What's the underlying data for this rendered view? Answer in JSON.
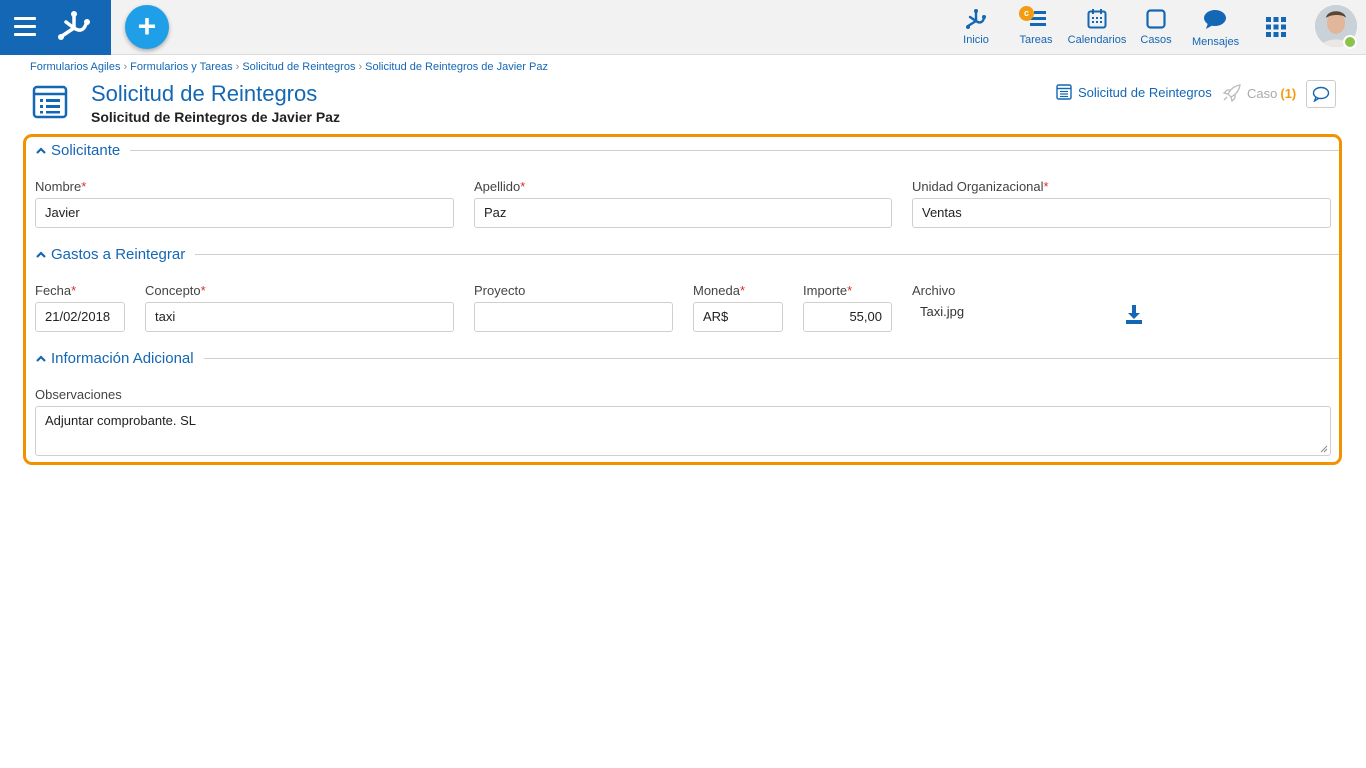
{
  "topbar": {
    "nav": [
      {
        "id": "inicio",
        "label": "Inicio"
      },
      {
        "id": "tareas",
        "label": "Tareas",
        "badge": "c"
      },
      {
        "id": "calendarios",
        "label": "Calendarios"
      },
      {
        "id": "casos",
        "label": "Casos"
      },
      {
        "id": "mensajes",
        "label": "Mensajes"
      }
    ]
  },
  "breadcrumb": [
    "Formularios Agiles",
    "Formularios y Tareas",
    "Solicitud de Reintegros",
    "Solicitud de Reintegros de Javier Paz"
  ],
  "header": {
    "title": "Solicitud de Reintegros",
    "subtitle": "Solicitud de Reintegros de Javier Paz",
    "form_link": "Solicitud de Reintegros",
    "case_label": "Caso",
    "case_count": "(1)"
  },
  "sections": {
    "solicitante": {
      "title": "Solicitante",
      "nombre_label": "Nombre",
      "nombre_value": "Javier",
      "apellido_label": "Apellido",
      "apellido_value": "Paz",
      "unidad_label": "Unidad Organizacional",
      "unidad_value": "Ventas"
    },
    "gastos": {
      "title": "Gastos a Reintegrar",
      "fecha_label": "Fecha",
      "fecha_value": "21/02/2018",
      "concepto_label": "Concepto",
      "concepto_value": "taxi",
      "proyecto_label": "Proyecto",
      "proyecto_value": "",
      "moneda_label": "Moneda",
      "moneda_value": "AR$",
      "importe_label": "Importe",
      "importe_value": "55,00",
      "archivo_label": "Archivo",
      "archivo_value": "Taxi.jpg"
    },
    "info": {
      "title": "Información Adicional",
      "obs_label": "Observaciones",
      "obs_value": "Adjuntar comprobante. SL"
    }
  },
  "required_marker": "*",
  "colors": {
    "brand": "#1467b4",
    "accent": "#1e9fe8",
    "highlight": "#f39200",
    "required": "#d9302c",
    "online": "#8bc34a"
  }
}
